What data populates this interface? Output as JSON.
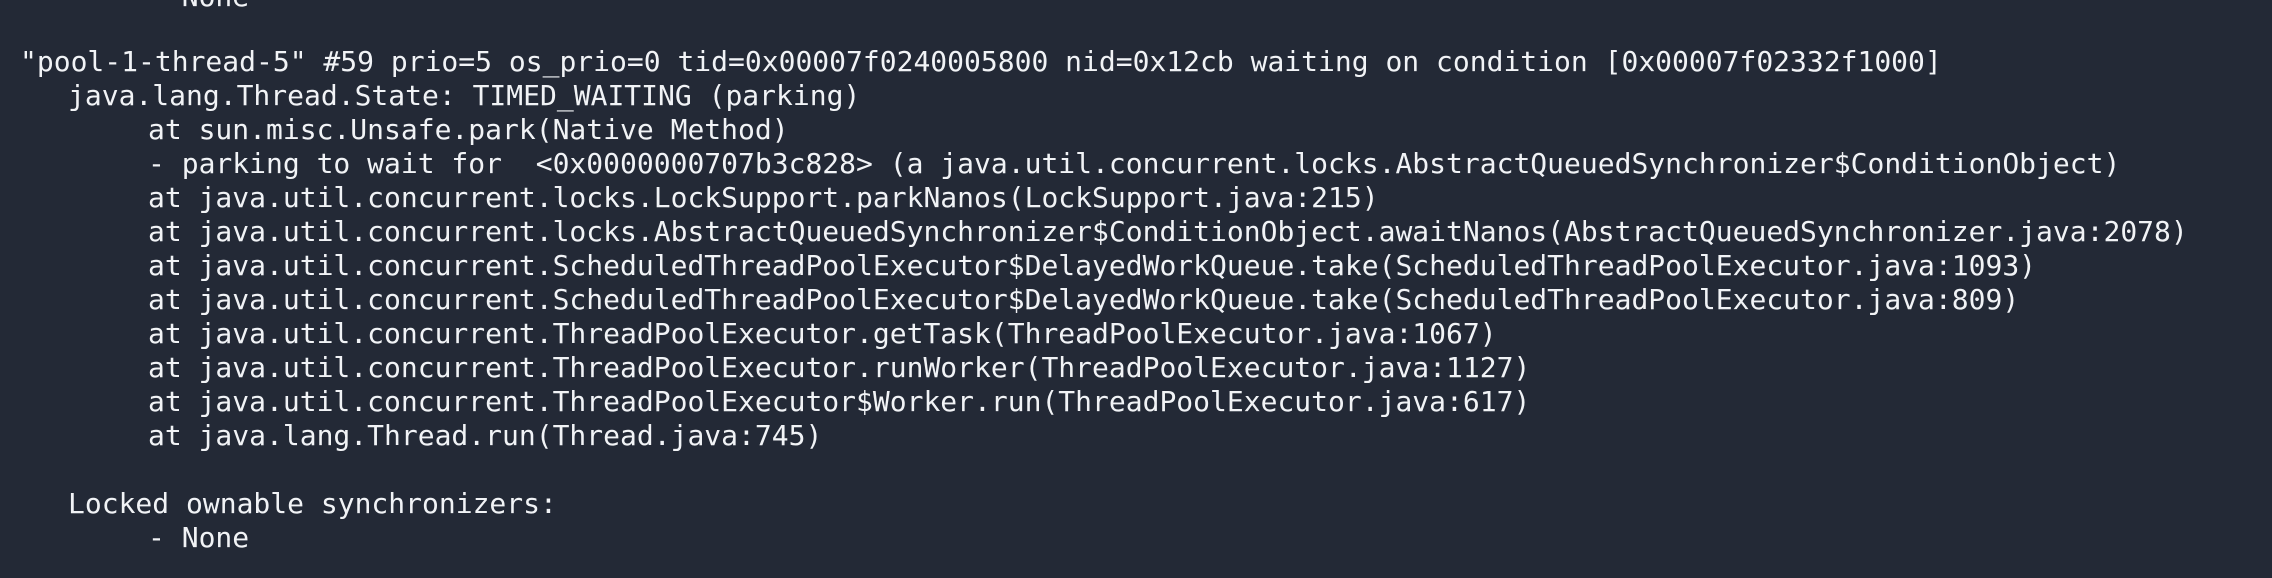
{
  "terminal": {
    "top_partial_line": "- None",
    "thread_header": "\"pool-1-thread-5\" #59 prio=5 os_prio=0 tid=0x00007f0240005800 nid=0x12cb waiting on condition [0x00007f02332f1000]",
    "thread_state": "java.lang.Thread.State: TIMED_WAITING (parking)",
    "stack": [
      "at sun.misc.Unsafe.park(Native Method)",
      "- parking to wait for  <0x0000000707b3c828> (a java.util.concurrent.locks.AbstractQueuedSynchronizer$ConditionObject)",
      "at java.util.concurrent.locks.LockSupport.parkNanos(LockSupport.java:215)",
      "at java.util.concurrent.locks.AbstractQueuedSynchronizer$ConditionObject.awaitNanos(AbstractQueuedSynchronizer.java:2078)",
      "at java.util.concurrent.ScheduledThreadPoolExecutor$DelayedWorkQueue.take(ScheduledThreadPoolExecutor.java:1093)",
      "at java.util.concurrent.ScheduledThreadPoolExecutor$DelayedWorkQueue.take(ScheduledThreadPoolExecutor.java:809)",
      "at java.util.concurrent.ThreadPoolExecutor.getTask(ThreadPoolExecutor.java:1067)",
      "at java.util.concurrent.ThreadPoolExecutor.runWorker(ThreadPoolExecutor.java:1127)",
      "at java.util.concurrent.ThreadPoolExecutor$Worker.run(ThreadPoolExecutor.java:617)",
      "at java.lang.Thread.run(Thread.java:745)"
    ],
    "locked_synchronizers_label": "Locked ownable synchronizers:",
    "locked_synchronizers_value": "- None"
  },
  "colors": {
    "background": "#232936",
    "text": "#f1f3f6"
  }
}
